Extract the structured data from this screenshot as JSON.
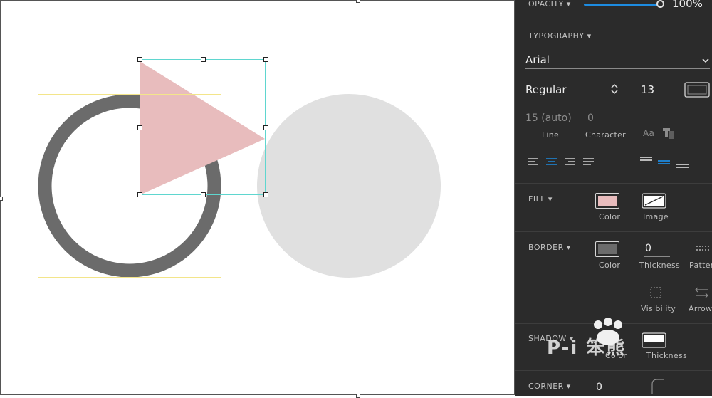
{
  "canvas": {
    "shapes": {
      "ring_color": "#6b6b6b",
      "triangle_color": "#e8bcbd",
      "circle_color": "#e0e0e0"
    },
    "selection_colors": {
      "primary": "#5fd6cf",
      "secondary": "#f3e58a"
    }
  },
  "panel": {
    "opacity": {
      "label": "OPACITY ▾",
      "value": "100%",
      "level": 1.0
    },
    "typography": {
      "label": "TYPOGRAPHY ▾",
      "font": "Arial",
      "weight": "Regular",
      "size": "13",
      "line_value": "15 (auto)",
      "line_label": "Line",
      "character_value": "0",
      "character_label": "Character",
      "case_icon_text": "Aa"
    },
    "fill": {
      "label": "FILL ▾",
      "color_label": "Color",
      "image_label": "Image",
      "color": "#e8bcbd"
    },
    "border": {
      "label": "BORDER ▾",
      "color_label": "Color",
      "thickness_value": "0",
      "thickness_label": "Thickness",
      "pattern_label": "Patter",
      "visibility_label": "Visibility",
      "arrow_label": "Arrow",
      "color": "#6b6b6b"
    },
    "shadow": {
      "label": "SHADOW ▾",
      "color_label": "Color",
      "thickness_label": "Thickness"
    },
    "corner": {
      "label": "CORNER ▾",
      "value": "0"
    },
    "accent": "#1d8be0"
  },
  "watermark": {
    "text": "P-i 笨熊"
  }
}
